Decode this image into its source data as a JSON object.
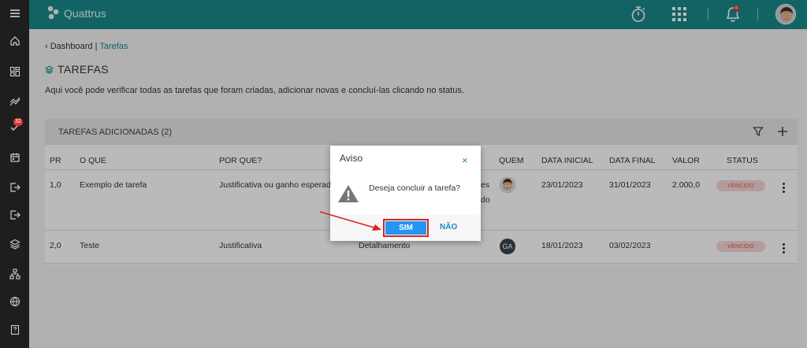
{
  "app": {
    "name": "Quattrus"
  },
  "topbar": {
    "bell_count": "6"
  },
  "sidebar": {
    "tasks_badge": "32"
  },
  "breadcrumb": {
    "parent": "Dashboard",
    "separator": "|",
    "current": "Tarefas"
  },
  "page": {
    "title": "TAREFAS",
    "description": "Aqui você pode verificar todas as tarefas que foram criadas, adicionar novas e concluí-las clicando no status."
  },
  "card": {
    "title": "TAREFAS ADICIONADAS (2)"
  },
  "table": {
    "headers": {
      "pr": "PR",
      "oque": "O QUE",
      "porque": "POR QUE?",
      "quem": "QUEM",
      "data_inicial": "DATA INICIAL",
      "data_final": "DATA FINAL",
      "valor": "VALOR",
      "status": "STATUS"
    },
    "rows": [
      {
        "pr": "1,0",
        "oque": "Exemplo de tarefa",
        "porque": "Justificativa ou ganho esperado",
        "detalhe_a": "es",
        "detalhe_b": "do",
        "data_inicial": "23/01/2023",
        "data_final": "31/01/2023",
        "valor": "2.000,0",
        "status": "VENCIDO"
      },
      {
        "pr": "2,0",
        "oque": "Teste",
        "porque": "Justificativa",
        "detalhe": "Detalhamento",
        "quem_initials": "GA",
        "data_inicial": "18/01/2023",
        "data_final": "03/02/2023",
        "valor": "",
        "status": "VENCIDO"
      }
    ]
  },
  "dialog": {
    "title": "Aviso",
    "close": "×",
    "message": "Deseja concluir a tarefa?",
    "confirm": "SIM",
    "cancel": "NÃO"
  },
  "colors": {
    "brand": "#1a8a8a",
    "primary_button": "#2196f3",
    "status_overdue": "#d9534f",
    "highlight": "#e02020"
  }
}
